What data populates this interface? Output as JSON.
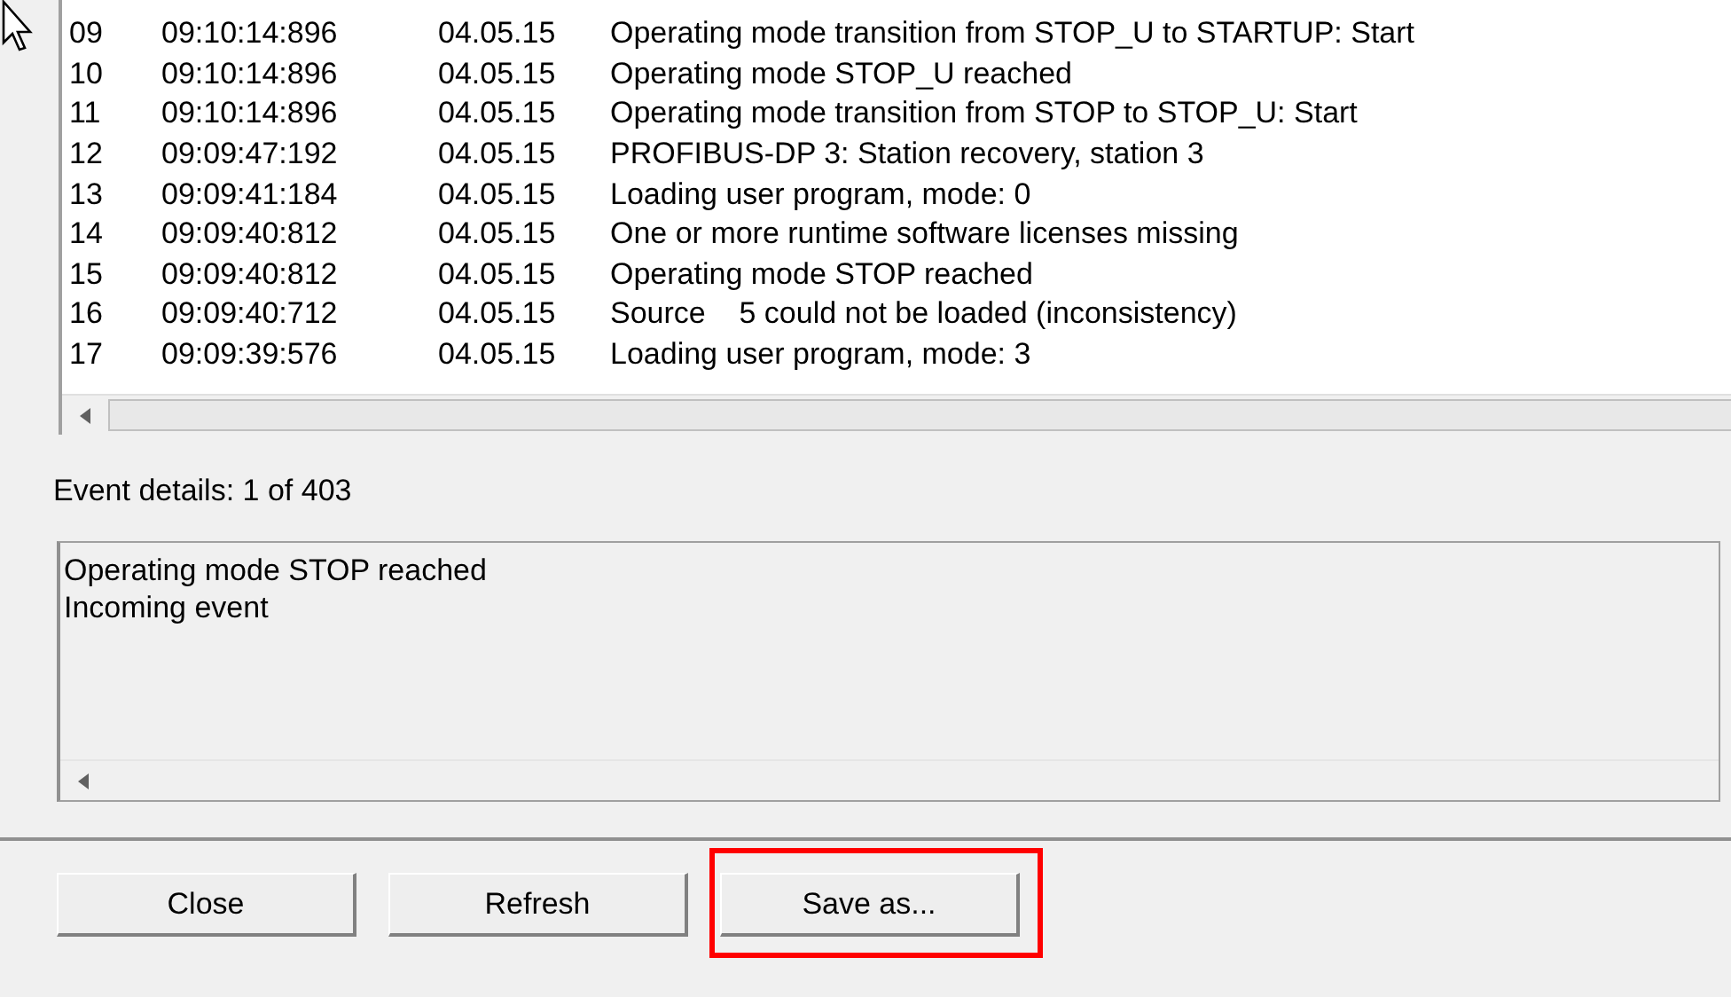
{
  "events": [
    {
      "number": "09",
      "time": "09:10:14:896",
      "date": "04.05.15",
      "message": "Operating mode transition from STOP_U to STARTUP: Start"
    },
    {
      "number": "10",
      "time": "09:10:14:896",
      "date": "04.05.15",
      "message": "Operating mode STOP_U reached"
    },
    {
      "number": "11",
      "time": "09:10:14:896",
      "date": "04.05.15",
      "message": "Operating mode transition from STOP to STOP_U: Start"
    },
    {
      "number": "12",
      "time": "09:09:47:192",
      "date": "04.05.15",
      "message": "PROFIBUS-DP 3: Station recovery, station 3"
    },
    {
      "number": "13",
      "time": "09:09:41:184",
      "date": "04.05.15",
      "message": "Loading user program, mode: 0"
    },
    {
      "number": "14",
      "time": "09:09:40:812",
      "date": "04.05.15",
      "message": "One or more runtime software licenses missing"
    },
    {
      "number": "15",
      "time": "09:09:40:812",
      "date": "04.05.15",
      "message": "Operating mode STOP reached"
    },
    {
      "number": "16",
      "time": "09:09:40:712",
      "date": "04.05.15",
      "message": "Source    5 could not be loaded (inconsistency)"
    },
    {
      "number": "17",
      "time": "09:09:39:576",
      "date": "04.05.15",
      "message": "Loading user program, mode: 3"
    }
  ],
  "event_details": {
    "label": "Event details:  1 of 403",
    "lines": [
      "Operating mode STOP reached",
      "Incoming event"
    ]
  },
  "buttons": [
    {
      "label": "Close",
      "highlighted": false
    },
    {
      "label": "Refresh",
      "highlighted": false
    },
    {
      "label": "Save as...",
      "highlighted": true
    }
  ]
}
